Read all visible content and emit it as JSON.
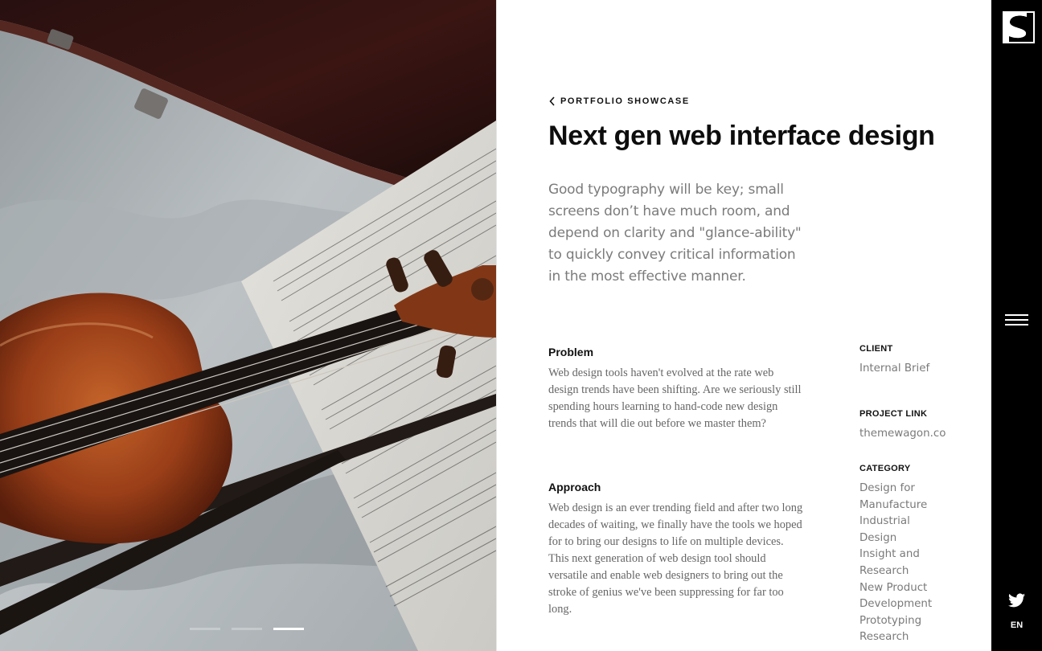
{
  "hero": {
    "image_alt": "violin-and-sheet-music-photo",
    "slides": [
      {
        "active": false
      },
      {
        "active": false
      },
      {
        "active": true
      }
    ]
  },
  "back_link": {
    "label": "PORTFOLIO SHOWCASE",
    "icon": "chevron-left-icon"
  },
  "title": "Next gen web interface design",
  "lead": "Good typography will be key; small screens don’t have much room, and depend on clarity and \"glance-ability\" to quickly convey critical information in the most effective manner.",
  "problem": {
    "heading": "Problem",
    "body": "Web design tools haven't evolved at the rate web design trends have been shifting. Are we seriously still spending hours learning to hand-code new design trends that will die out before we master them?"
  },
  "approach": {
    "heading": "Approach",
    "body": "Web design is an ever trending field and after two long decades of waiting, we finally have the tools we hoped for to bring our designs to life on multiple devices. This next generation of web design tool should versatile and enable web designers to bring out the stroke of genius we've been suppressing for far too long."
  },
  "meta": {
    "client_label": "CLIENT",
    "client_value": "Internal Brief",
    "project_link_label": "PROJECT LINK",
    "project_link_value": "themewagon.co",
    "category_label": "CATEGORY",
    "categories": [
      "Design for Manufacture",
      "Industrial Design",
      "Insight and Research",
      "New Product Development",
      "Prototyping Research"
    ]
  },
  "rail": {
    "logo_icon": "brand-s-logo-icon",
    "menu_icon": "hamburger-menu-icon",
    "social_icon": "twitter-icon",
    "language": "EN"
  },
  "colors": {
    "rail_bg": "#000000",
    "text_dark": "#111111",
    "text_muted": "#7a7a7a"
  }
}
